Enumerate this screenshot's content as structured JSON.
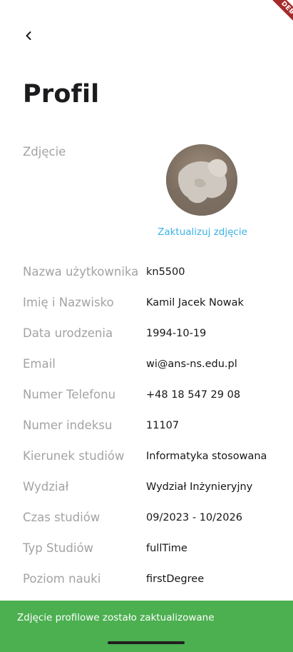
{
  "header": {
    "back_icon": "chevron-left-icon",
    "title": "Profil"
  },
  "photo": {
    "label": "Zdjęcie",
    "update_link": "Zaktualizuj zdjęcie"
  },
  "fields": [
    {
      "label": "Nazwa użytkownika",
      "value": "kn5500"
    },
    {
      "label": "Imię i Nazwisko",
      "value": "Kamil Jacek Nowak"
    },
    {
      "label": "Data urodzenia",
      "value": "1994-10-19"
    },
    {
      "label": "Email",
      "value": "wi@ans-ns.edu.pl"
    },
    {
      "label": "Numer Telefonu",
      "value": "+48 18 547 29 08"
    },
    {
      "label": "Numer indeksu",
      "value": "11107"
    },
    {
      "label": "Kierunek studiów",
      "value": "Informatyka stosowana"
    },
    {
      "label": "Wydział",
      "value": "Wydział Inżynieryjny"
    },
    {
      "label": "Czas studiów",
      "value": "09/2023 - 10/2026"
    },
    {
      "label": "Typ Studiów",
      "value": "fullTime"
    },
    {
      "label": "Poziom nauki",
      "value": "firstDegree"
    }
  ],
  "snackbar": {
    "message": "Zdjęcie profilowe zostało zaktualizowane"
  },
  "debug_banner": {
    "label": "DEBUG"
  },
  "colors": {
    "accent": "#3bb2e6",
    "snackbar": "#4caf50",
    "label": "#a3a3a3",
    "value": "#161616",
    "debug": "#a52a2a"
  }
}
